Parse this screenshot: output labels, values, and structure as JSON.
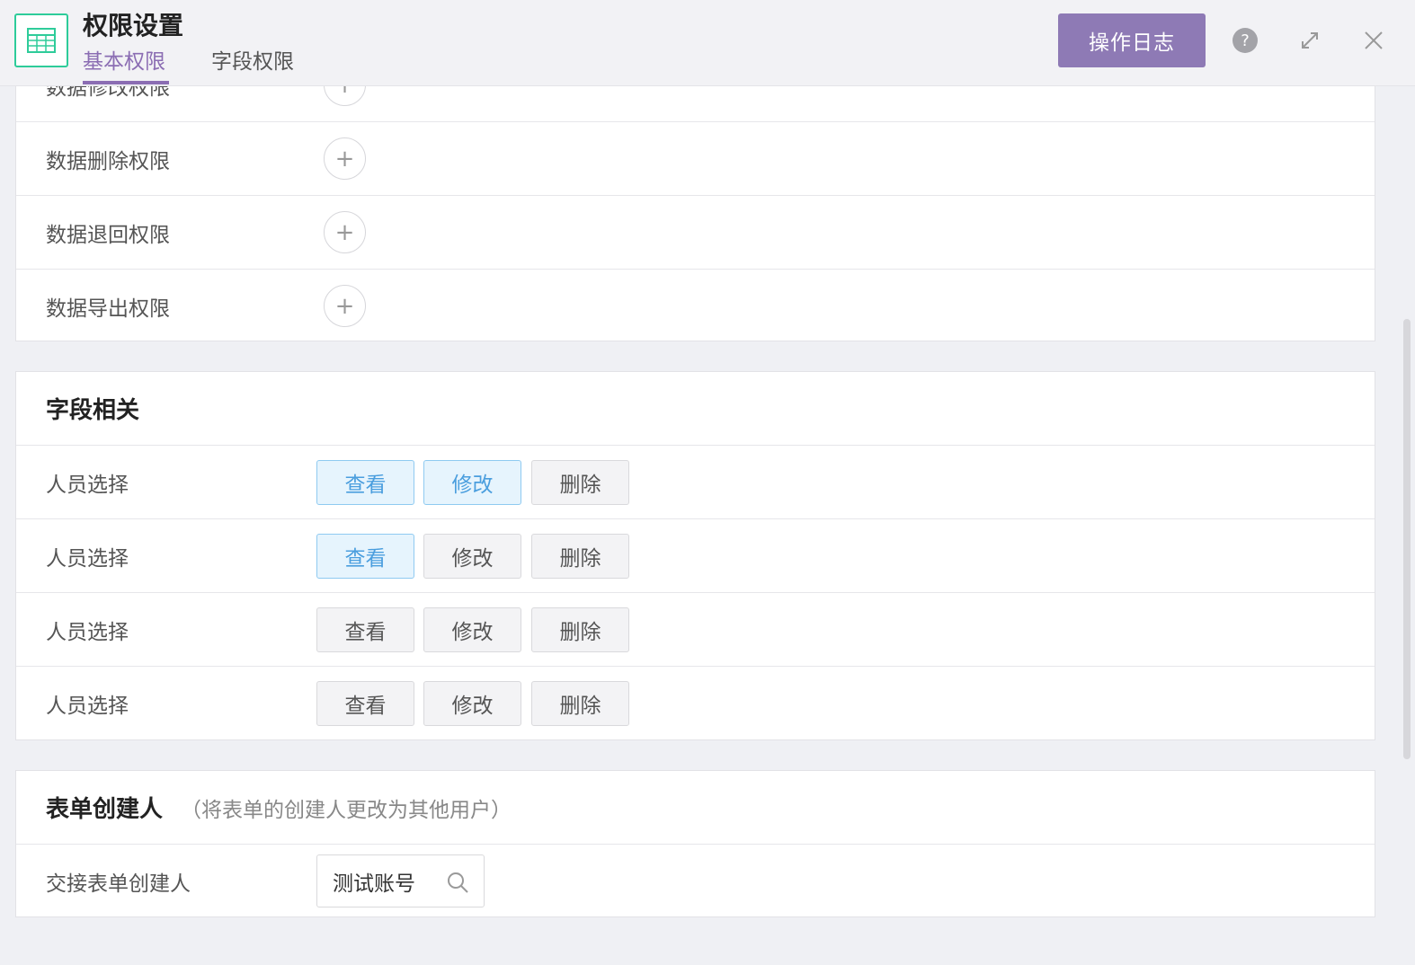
{
  "header": {
    "title": "权限设置",
    "tabs": [
      {
        "label": "基本权限",
        "active": true
      },
      {
        "label": "字段权限",
        "active": false
      }
    ],
    "log_button": "操作日志",
    "icons": [
      "table-icon",
      "help-icon",
      "expand-icon",
      "close-icon"
    ],
    "accent_color": "#8e7ab5"
  },
  "basic_permissions": {
    "rows": [
      {
        "label": "数据修改权限"
      },
      {
        "label": "数据删除权限"
      },
      {
        "label": "数据退回权限"
      },
      {
        "label": "数据导出权限"
      }
    ],
    "add_symbol": "+"
  },
  "field_section": {
    "title": "字段相关",
    "rows": [
      {
        "label": "人员选择",
        "buttons": [
          {
            "label": "查看",
            "on": true
          },
          {
            "label": "修改",
            "on": true
          },
          {
            "label": "删除",
            "on": false
          }
        ]
      },
      {
        "label": "人员选择",
        "buttons": [
          {
            "label": "查看",
            "on": true
          },
          {
            "label": "修改",
            "on": false
          },
          {
            "label": "删除",
            "on": false
          }
        ]
      },
      {
        "label": "人员选择",
        "buttons": [
          {
            "label": "查看",
            "on": false
          },
          {
            "label": "修改",
            "on": false
          },
          {
            "label": "删除",
            "on": false
          }
        ]
      },
      {
        "label": "人员选择",
        "buttons": [
          {
            "label": "查看",
            "on": false
          },
          {
            "label": "修改",
            "on": false
          },
          {
            "label": "删除",
            "on": false
          }
        ]
      }
    ]
  },
  "creator_section": {
    "title": "表单创建人",
    "subtitle": "（将表单的创建人更改为其他用户）",
    "row_label": "交接表单创建人",
    "search_value": "测试账号"
  }
}
